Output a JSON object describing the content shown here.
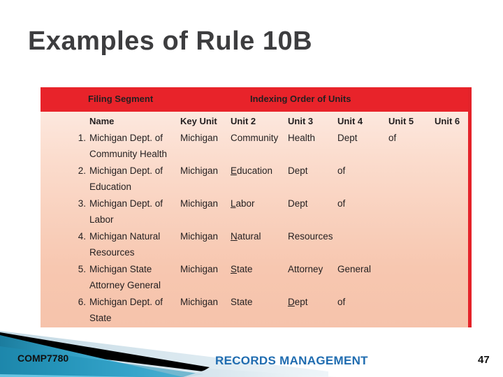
{
  "slide": {
    "title": "Examples of Rule 10B"
  },
  "table": {
    "band": {
      "filing_segment": "Filing Segment",
      "indexing_order": "Indexing Order of Units"
    },
    "columns": [
      "Name",
      "Key Unit",
      "Unit 2",
      "Unit 3",
      "Unit 4",
      "Unit 5",
      "Unit 6"
    ],
    "rows": [
      {
        "num": "1.",
        "name_line1": "Michigan Dept. of",
        "name_line2": "Community Health",
        "units": [
          "Michigan",
          "Community",
          "Health",
          "Dept",
          "of",
          ""
        ]
      },
      {
        "num": "2.",
        "name_line1": "Michigan Dept. of",
        "name_line2": "Education",
        "units": [
          "Michigan",
          "Education",
          "Dept",
          "of",
          "",
          ""
        ]
      },
      {
        "num": "3.",
        "name_line1": "Michigan Dept. of",
        "name_line2": "Labor",
        "units": [
          "Michigan",
          "Labor",
          "Dept",
          "of",
          "",
          ""
        ]
      },
      {
        "num": "4.",
        "name_line1": "Michigan Natural",
        "name_line2": "Resources",
        "units": [
          "Michigan",
          "Natural",
          "Resources",
          "",
          "",
          ""
        ]
      },
      {
        "num": "5.",
        "name_line1": "Michigan State",
        "name_line2": "Attorney General",
        "units": [
          "Michigan",
          "State",
          "Attorney",
          "General",
          "",
          ""
        ]
      },
      {
        "num": "6.",
        "name_line1": "Michigan Dept. of",
        "name_line2": "State",
        "units": [
          "Michigan",
          "State",
          "Dept",
          "of",
          "",
          ""
        ]
      }
    ]
  },
  "footer": {
    "course_code": "COMP7780",
    "subject": "RECORDS MANAGEMENT",
    "page_number": "47"
  },
  "colors": {
    "header_red": "#e8232a",
    "table_border_red": "#e42229",
    "title_gray": "#3d3d3f",
    "subject_blue": "#1f6cb0",
    "deco_blue_dark": "#1c7fa3",
    "deco_blue_light": "#5cc3e4",
    "deco_black": "#000000",
    "deco_pale": "#d8e7ef"
  }
}
